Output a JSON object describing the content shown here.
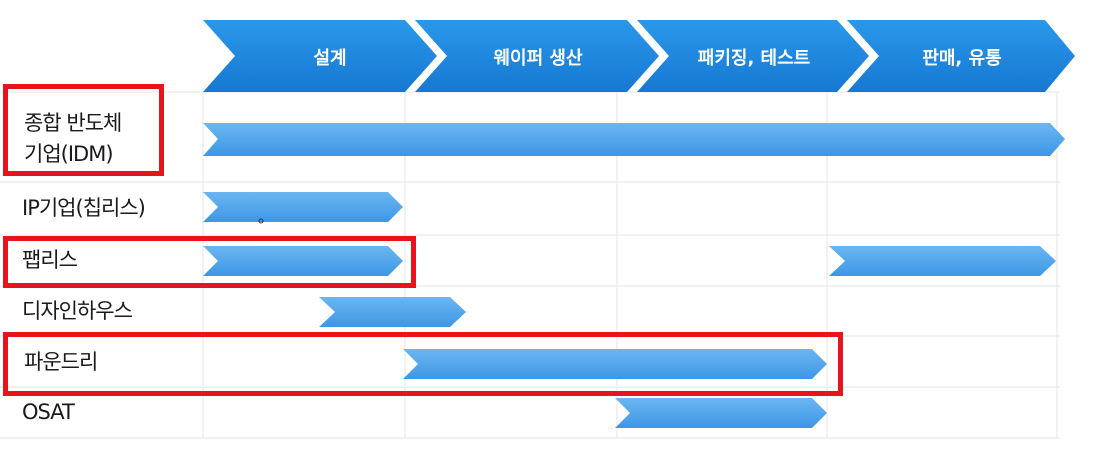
{
  "stages": [
    "설계",
    "웨이퍼 생산",
    "패키징, 테스트",
    "판매, 유통"
  ],
  "rows": [
    {
      "label_line1": "종합 반도체",
      "label_line2": "기업(IDM)"
    },
    {
      "label": "IP기업(칩리스)"
    },
    {
      "label": "팹리스"
    },
    {
      "label": "디자인하우스"
    },
    {
      "label": "파운드리"
    },
    {
      "label": "OSAT"
    }
  ],
  "colors": {
    "stage_arrow": "#1f8be0",
    "bar_arrow": "#4aa3ec",
    "highlight": "#e8141c",
    "grid": "#e3e6ea"
  }
}
